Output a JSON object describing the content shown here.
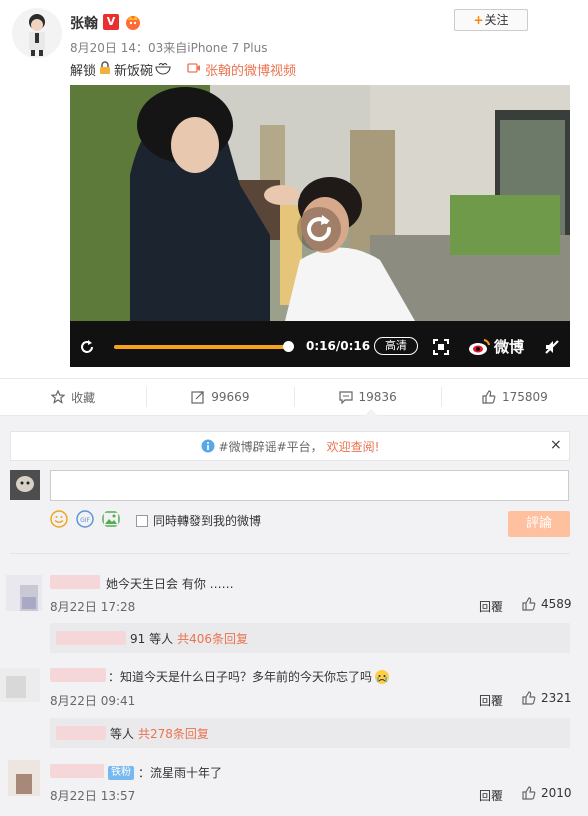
{
  "post": {
    "username": "张翰",
    "verified_badge": "V",
    "follow_label": "关注",
    "meta": "8月20日 14：03来自iPhone 7 Plus",
    "caption_a": "解锁",
    "caption_b": "新饭碗",
    "video_link": "张翰的微博视频"
  },
  "video": {
    "timecode": "0:16/0:16",
    "quality": "高清",
    "brand": "微博",
    "progress": 1.0
  },
  "actions": [
    {
      "label": "收藏",
      "icon": "star-icon"
    },
    {
      "label": "99669",
      "icon": "repost-icon"
    },
    {
      "label": "19836",
      "icon": "comment-icon"
    },
    {
      "label": "175809",
      "icon": "thumbs-up-icon"
    }
  ],
  "notice": {
    "text": "#微博辟谣#平台，",
    "link": "欢迎查阅!",
    "close": "×"
  },
  "composer": {
    "repost_label": "同時轉發到我的微博",
    "submit_label": "評論"
  },
  "comments": [
    {
      "text": "她今天生日会 有你 ……",
      "time": "8月22日 17:28",
      "reply": "回覆",
      "likes": "4589",
      "reply_summary": {
        "suffix": "91 等人",
        "count": "共406条回复"
      }
    },
    {
      "text": "：知道今天是什么日子吗？多年前的今天你忘了吗",
      "time": "8月22日 09:41",
      "reply": "回覆",
      "likes": "2321",
      "reply_summary": {
        "suffix": "等人",
        "count": "共278条回复"
      }
    },
    {
      "badge": "铁粉",
      "text": "：流星雨十年了",
      "time": "8月22日 13:57",
      "reply": "回覆",
      "likes": "2010"
    }
  ],
  "colors": {
    "accent": "#eb7350",
    "brand_orange": "#ff8200",
    "progress": "#f7a21b",
    "submit": "#ffc09f"
  }
}
